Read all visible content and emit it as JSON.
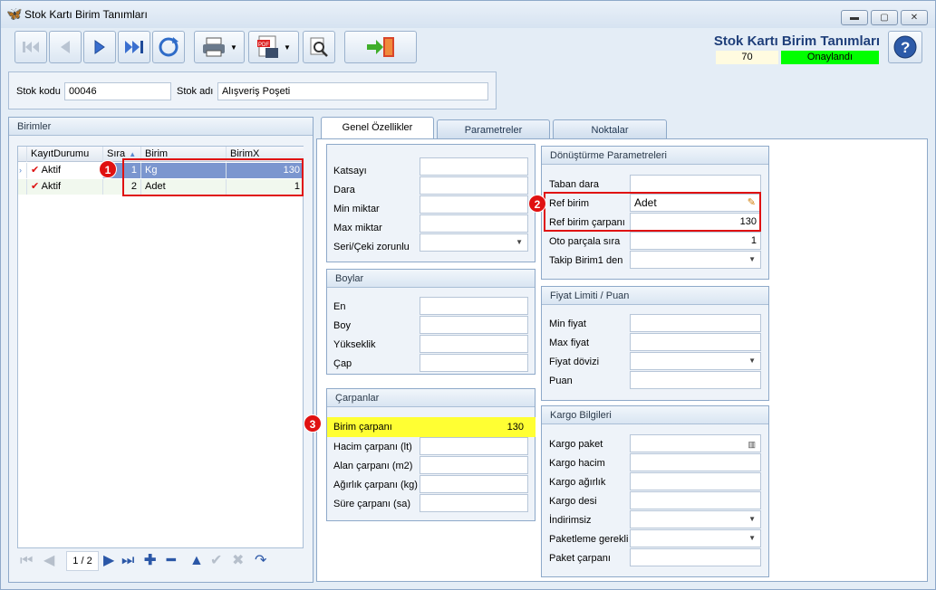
{
  "window": {
    "title": "Stok Kartı Birim Tanımları",
    "header_title": "Stok Kartı Birim Tanımları",
    "record_no": "70",
    "status": "Onaylandı",
    "status_color": "#00ff00",
    "accent": "#1f3f7a"
  },
  "stock": {
    "code_label": "Stok kodu",
    "code_value": "00046",
    "name_label": "Stok adı",
    "name_value": "Alışveriş Poşeti"
  },
  "units_panel": {
    "title": "Birimler",
    "columns": [
      "KayıtDurumu",
      "Sıra",
      "Birim",
      "BirimX"
    ],
    "rows": [
      {
        "status": "Aktif",
        "order": "1",
        "unit": "Kg",
        "factor": "130"
      },
      {
        "status": "Aktif",
        "order": "2",
        "unit": "Adet",
        "factor": "1"
      }
    ],
    "pager": "1 / 2"
  },
  "tabs": [
    "Genel Özellikler",
    "Parametreler",
    "Noktalar"
  ],
  "general": {
    "fields": [
      "Katsayı",
      "Dara",
      "Min miktar",
      "Max miktar",
      "Seri/Çeki zorunlu"
    ]
  },
  "boylar": {
    "title": "Boylar",
    "fields": [
      "En",
      "Boy",
      "Yükseklik",
      "Çap"
    ]
  },
  "carpanlar": {
    "title": "Çarpanlar",
    "fields": [
      "Birim çarpanı",
      "Hacim çarpanı (lt)",
      "Alan çarpanı (m2)",
      "Ağırlık çarpanı (kg)",
      "Süre çarpanı (sa)"
    ],
    "birim_carpani_value": "130"
  },
  "donusturme": {
    "title": "Dönüştürme Parametreleri",
    "fields": [
      "Taban dara",
      "Ref birim",
      "Ref birim çarpanı",
      "Oto parçala sıra",
      "Takip Birim1 den"
    ],
    "ref_birim_value": "Adet",
    "ref_carpan_value": "130",
    "oto_parcala_value": "1"
  },
  "fiyat": {
    "title": "Fiyat Limiti / Puan",
    "fields": [
      "Min fiyat",
      "Max fiyat",
      "Fiyat dövizi",
      "Puan"
    ]
  },
  "kargo": {
    "title": "Kargo Bilgileri",
    "fields": [
      "Kargo paket",
      "Kargo hacim",
      "Kargo ağırlık",
      "Kargo desi",
      "İndirimsiz",
      "Paketleme gerekli",
      "Paket çarpanı"
    ]
  },
  "badges": [
    "1",
    "2",
    "3"
  ]
}
